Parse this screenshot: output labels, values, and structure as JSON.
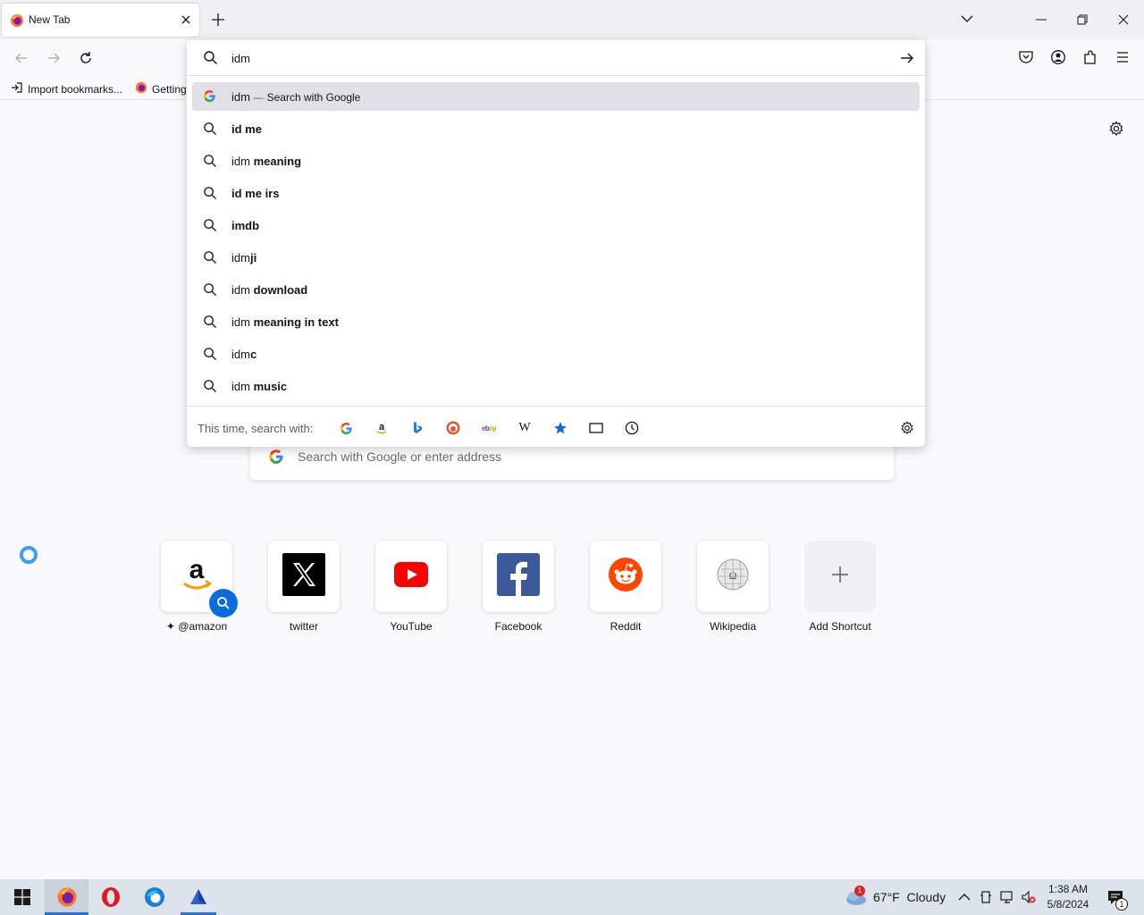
{
  "tab": {
    "title": "New Tab"
  },
  "bookmarks": {
    "import_label": "Import bookmarks...",
    "getting_started_label": "Getting"
  },
  "urlbar": {
    "value": "idm",
    "results": [
      {
        "typed": "idm",
        "suffix": "",
        "sep": " — ",
        "action": "Search with Google",
        "icon": "google-icon"
      },
      {
        "typed": "",
        "suffix": "id me",
        "icon": "search-icon"
      },
      {
        "typed": "idm ",
        "suffix": "meaning",
        "icon": "search-icon"
      },
      {
        "typed": "",
        "suffix": "id me irs",
        "icon": "search-icon"
      },
      {
        "typed": "",
        "suffix": "imdb",
        "icon": "search-icon"
      },
      {
        "typed": "idm",
        "suffix": "ji",
        "icon": "search-icon"
      },
      {
        "typed": "idm ",
        "suffix": "download",
        "icon": "search-icon"
      },
      {
        "typed": "idm ",
        "suffix": "meaning in text",
        "icon": "search-icon"
      },
      {
        "typed": "idm",
        "suffix": "c",
        "icon": "search-icon"
      },
      {
        "typed": "idm ",
        "suffix": "music",
        "icon": "search-icon"
      }
    ],
    "oneoff_label": "This time, search with:",
    "oneoff_engines": [
      "google-icon",
      "amazon-icon",
      "bing-icon",
      "duckduckgo-icon",
      "ebay-icon",
      "wikipedia-icon",
      "bookmarks-star-icon",
      "tabs-icon",
      "history-clock-icon",
      "settings-gear-icon"
    ]
  },
  "newtab": {
    "search_placeholder": "Search with Google or enter address",
    "shortcuts": [
      {
        "label": "@amazon",
        "icon": "amazon-logo"
      },
      {
        "label": "twitter",
        "icon": "x-logo"
      },
      {
        "label": "YouTube",
        "icon": "youtube-logo"
      },
      {
        "label": "Facebook",
        "icon": "facebook-logo"
      },
      {
        "label": "Reddit",
        "icon": "reddit-logo"
      },
      {
        "label": "Wikipedia",
        "icon": "wikipedia-logo"
      },
      {
        "label": "Add Shortcut",
        "icon": "plus-icon"
      }
    ]
  },
  "taskbar": {
    "weather": "67°F  Cloudy",
    "weather_badge": "1",
    "time": "1:38 AM",
    "date": "5/8/2024",
    "notification_count": "1"
  },
  "colors": {
    "accent": "#0b6cdb",
    "selected_row": "#e0e0e6",
    "taskbar": "#dde3ea"
  }
}
